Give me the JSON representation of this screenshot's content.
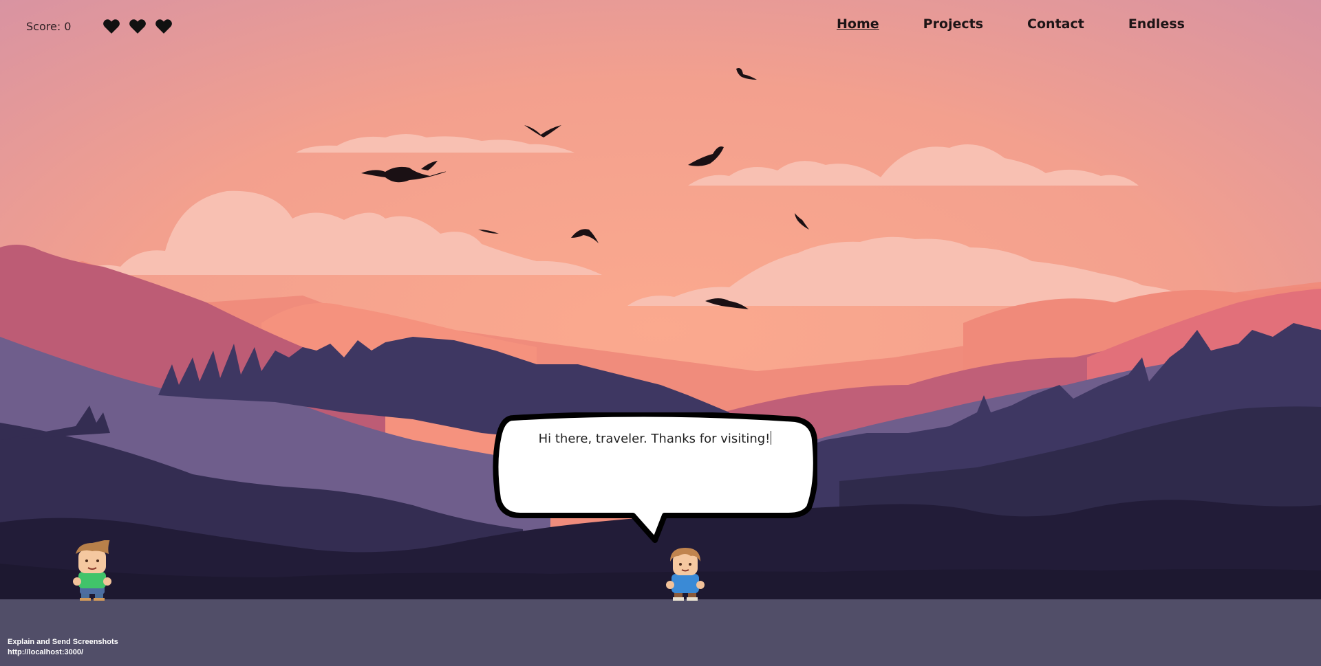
{
  "hud": {
    "score_label": "Score: 0",
    "lives": 3,
    "heart_icon": "heart-icon"
  },
  "nav": {
    "items": [
      {
        "label": "Home",
        "active": true
      },
      {
        "label": "Projects",
        "active": false
      },
      {
        "label": "Contact",
        "active": false
      },
      {
        "label": "Endless",
        "active": false
      }
    ]
  },
  "dialog": {
    "text": "Hi there, traveler. Thanks for visiting!"
  },
  "footer": {
    "line1": "Explain and Send Screenshots",
    "line2": "http://localhost:3000/"
  },
  "colors": {
    "sky_top": "#dc95a0",
    "sky_mid": "#f4a08c",
    "ground": "#514e68",
    "nav_text": "#1d1416"
  }
}
